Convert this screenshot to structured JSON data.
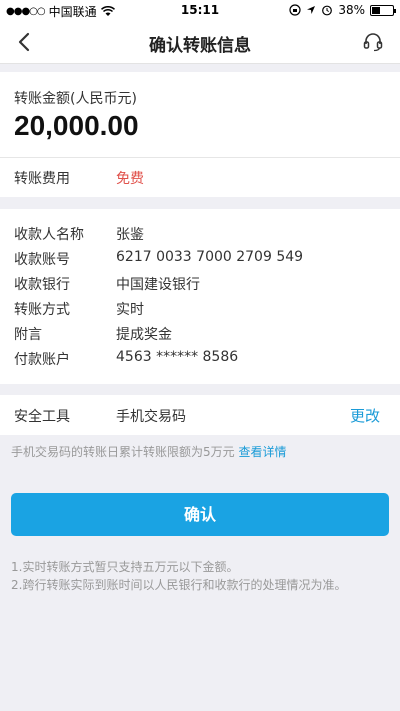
{
  "status_bar": {
    "carrier": "中国联通",
    "time": "15:11",
    "battery": "38%",
    "battery_level": 0.38
  },
  "nav": {
    "title": "确认转账信息"
  },
  "amount": {
    "label": "转账金额(人民币元)",
    "value": "20,000.00",
    "fee_label": "转账费用",
    "fee_value": "免费"
  },
  "details": [
    {
      "label": "收款人名称",
      "value": "张鉴"
    },
    {
      "label": "收款账号",
      "value": "6217 0033 7000 2709 549"
    },
    {
      "label": "收款银行",
      "value": "中国建设银行"
    },
    {
      "label": "转账方式",
      "value": "实时"
    },
    {
      "label": "附言",
      "value": "提成奖金"
    },
    {
      "label": "付款账户",
      "value": "4563 ****** 8586"
    }
  ],
  "security": {
    "label": "安全工具",
    "value": "手机交易码",
    "change": "更改"
  },
  "limit_note": {
    "text": "手机交易码的转账日累计转账限额为5万元",
    "link": "查看详情"
  },
  "confirm_button": "确认",
  "notes": [
    "1.实时转账方式暂只支持五万元以下金额。",
    "2.跨行转账实际到账时间以人民银行和收款行的处理情况为准。"
  ],
  "colors": {
    "accent": "#1aa3e3",
    "link": "#1a9bd7",
    "free": "#e0504a"
  }
}
